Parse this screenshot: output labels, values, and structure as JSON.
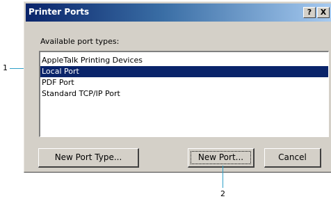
{
  "dialog": {
    "title": "Printer Ports",
    "help_glyph": "?",
    "close_glyph": "X",
    "prompt_label": "Available port types:",
    "port_types": [
      {
        "label": "AppleTalk Printing Devices",
        "selected": false
      },
      {
        "label": "Local Port",
        "selected": true
      },
      {
        "label": "PDF Port",
        "selected": false
      },
      {
        "label": "Standard TCP/IP Port",
        "selected": false
      }
    ],
    "buttons": {
      "new_port_type": "New Port Type...",
      "new_port": "New Port...",
      "cancel": "Cancel"
    }
  },
  "callouts": {
    "one": "1",
    "two": "2"
  },
  "colors": {
    "title_gradient_start": "#0a246a",
    "selection": "#0a246a",
    "face": "#d4d0c8",
    "callout_line": "#2fa0c8"
  }
}
